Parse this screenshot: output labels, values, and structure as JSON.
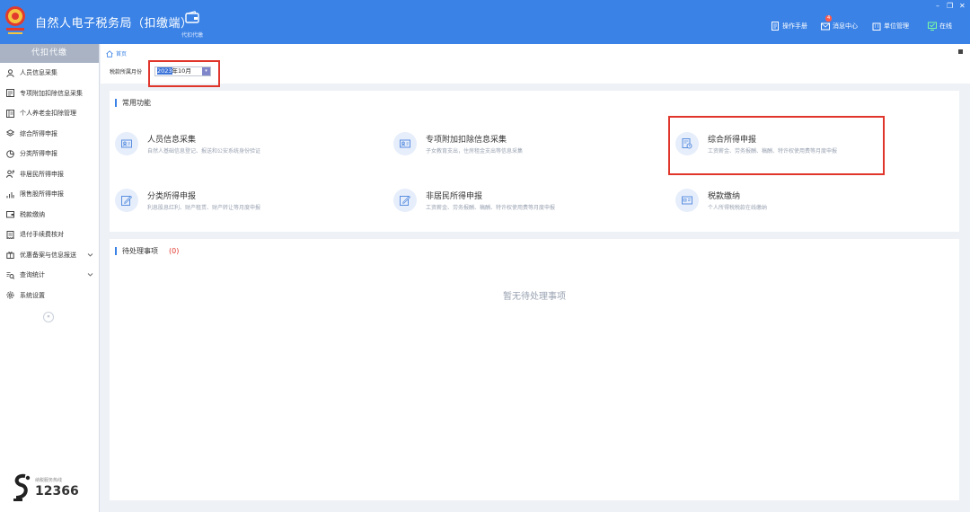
{
  "app": {
    "title": "自然人电子税务局（扣缴端）"
  },
  "nav": {
    "item_label": "代扣代缴"
  },
  "header_links": {
    "manual": "操作手册",
    "messages": "消息中心",
    "messages_badge": "4",
    "unit_mgmt": "单位管理",
    "online": "在线"
  },
  "sidebar": {
    "title": "代扣代缴",
    "items": [
      {
        "label": "人员信息采集"
      },
      {
        "label": "专项附加扣除信息采集"
      },
      {
        "label": "个人养老金扣除管理"
      },
      {
        "label": "综合所得申报"
      },
      {
        "label": "分类所得申报"
      },
      {
        "label": "非居民所得申报"
      },
      {
        "label": "限售股所得申报"
      },
      {
        "label": "税款缴纳"
      },
      {
        "label": "退付手续费核对"
      },
      {
        "label": "优惠备案与信息报送"
      },
      {
        "label": "查询统计"
      },
      {
        "label": "系统设置"
      }
    ],
    "hotline_label": "纳税服务热线",
    "hotline_number": "12366"
  },
  "breadcrumb": {
    "home": "首页"
  },
  "period": {
    "label": "税款所属月份",
    "value_selected": "2023",
    "value_rest": "年10月"
  },
  "common": {
    "title": "常用功能",
    "functions": [
      {
        "name": "人员信息采集",
        "desc": "自然人基础信息登记、报送和公安系统身份验证"
      },
      {
        "name": "专项附加扣除信息采集",
        "desc": "子女教育支出，住房租金支出等信息采集"
      },
      {
        "name": "综合所得申报",
        "desc": "工资薪金、劳务报酬、稿酬、特许权使用费等月度申报"
      },
      {
        "name": "分类所得申报",
        "desc": "利息股息红利、财产租赁、财产转让等月度申报"
      },
      {
        "name": "非居民所得申报",
        "desc": "工资薪金、劳务报酬、稿酬、特许权使用费等月度申报"
      },
      {
        "name": "税款缴纳",
        "desc": "个人所得税税款在线缴纳"
      }
    ]
  },
  "pending": {
    "title": "待处理事项",
    "count": "(0)",
    "empty_text": "暂无待处理事项"
  },
  "colors": {
    "header": "#3a82e6",
    "highlight": "#e0352b",
    "accent": "#3a82e6"
  }
}
